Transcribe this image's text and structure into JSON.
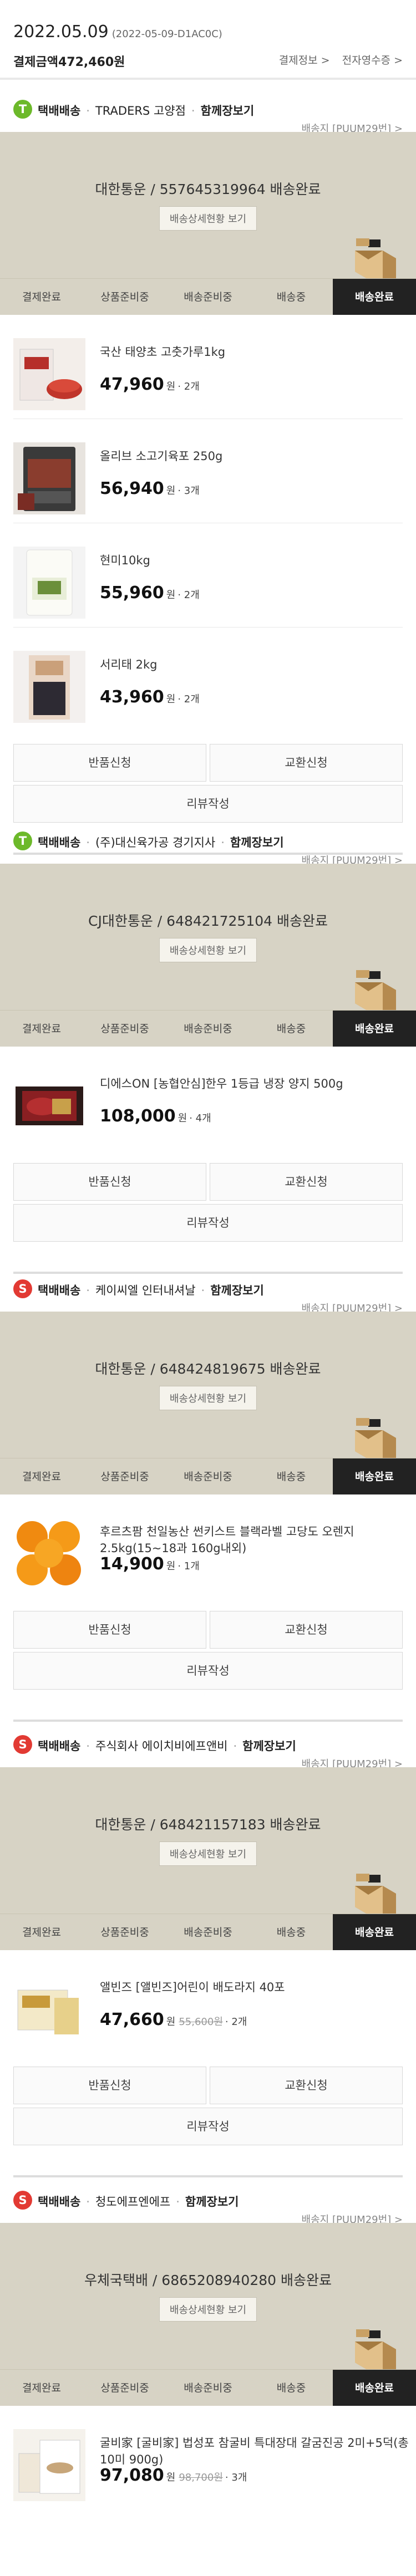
{
  "order": {
    "date": "2022.05.09",
    "order_code": "(2022-05-09-D1AC0C)",
    "total_label": "결제금액",
    "total_value": "472,460원",
    "links": [
      "결제정보 >",
      "전자영수증 >"
    ]
  },
  "steps": [
    "결제완료",
    "상품준비중",
    "배송준비중",
    "배송중",
    "배송완료"
  ],
  "status_button": "배송상세현황 보기",
  "actions": {
    "return": "반품신청",
    "exchange": "교환신청",
    "review": "리뷰작성"
  },
  "shipments": [
    {
      "badge": "T",
      "badge_color": "#6cb92a",
      "method": "택배배송",
      "seller": "TRADERS 고양점",
      "bundle": "함께장보기",
      "address": "배송지 [PUUM29번] >",
      "carrier_status": "대한통운 / 557645319964 배송완료",
      "items": [
        {
          "name": "국산 태양초 고춧가루1kg",
          "price": "47,960",
          "unit": "원",
          "qty": "· 2개",
          "image": "chili-powder-image"
        },
        {
          "name": "올리브 소고기육포 250g",
          "price": "56,940",
          "unit": "원",
          "qty": "· 3개",
          "image": "jerky-image"
        },
        {
          "name": "현미10kg",
          "price": "55,960",
          "unit": "원",
          "qty": "· 2개",
          "image": "rice-bag-image"
        },
        {
          "name": "서리태 2kg",
          "price": "43,960",
          "unit": "원",
          "qty": "· 2개",
          "image": "black-beans-image"
        }
      ]
    },
    {
      "badge": "T",
      "badge_color": "#6cb92a",
      "method": "택배배송",
      "seller": "(주)대신육가공 경기지사",
      "bundle": "함께장보기",
      "address": "배송지 [PUUM29번] >",
      "carrier_status": "CJ대한통운 / 648421725104 배송완료",
      "items": [
        {
          "name": "디에스ON [농협안심]한우 1등급 냉장 양지 500g",
          "price": "108,000",
          "unit": "원",
          "qty": "· 4개",
          "image": "beef-pack-image"
        }
      ]
    },
    {
      "badge": "S",
      "badge_color": "#e23a33",
      "method": "택배배송",
      "seller": "케이씨엘 인터내셔날",
      "bundle": "함께장보기",
      "address": "배송지 [PUUM29번] >",
      "carrier_status": "대한통운 / 648424819675 배송완료",
      "items": [
        {
          "name": "후르츠팜 천일농산 썬키스트 블랙라벨 고당도 오렌지 2.5kg(15~18과 160g내외)",
          "price": "14,900",
          "unit": "원",
          "qty": "· 1개",
          "image": "oranges-image"
        }
      ]
    },
    {
      "badge": "S",
      "badge_color": "#e23a33",
      "method": "택배배송",
      "seller": "주식회사 에이치비에프앤비",
      "bundle": "함께장보기",
      "address": "배송지 [PUUM29번] >",
      "carrier_status": "대한통운 / 648421157183 배송완료",
      "items": [
        {
          "name": "앨빈즈 [앨빈즈]어린이 배도라지 40포",
          "price": "47,660",
          "unit": "원",
          "original": "55,600원",
          "qty": "· 2개",
          "image": "pouch-box-image"
        }
      ]
    },
    {
      "badge": "S",
      "badge_color": "#e23a33",
      "method": "택배배송",
      "seller": "청도에프엔에프",
      "bundle": "함께장보기",
      "address": "배송지 [PUUM29번] >",
      "carrier_status": "우체국택배 / 6865208940280 배송완료",
      "items": [
        {
          "name": "굴비家 [굴비家] 법성포 참굴비 특대장대 갈굼진공 2미+5덕(총 10미 900g)",
          "price": "97,080",
          "unit": "원",
          "original": "98,700원",
          "qty": "· 3개",
          "image": "fish-pack-image"
        }
      ]
    }
  ]
}
